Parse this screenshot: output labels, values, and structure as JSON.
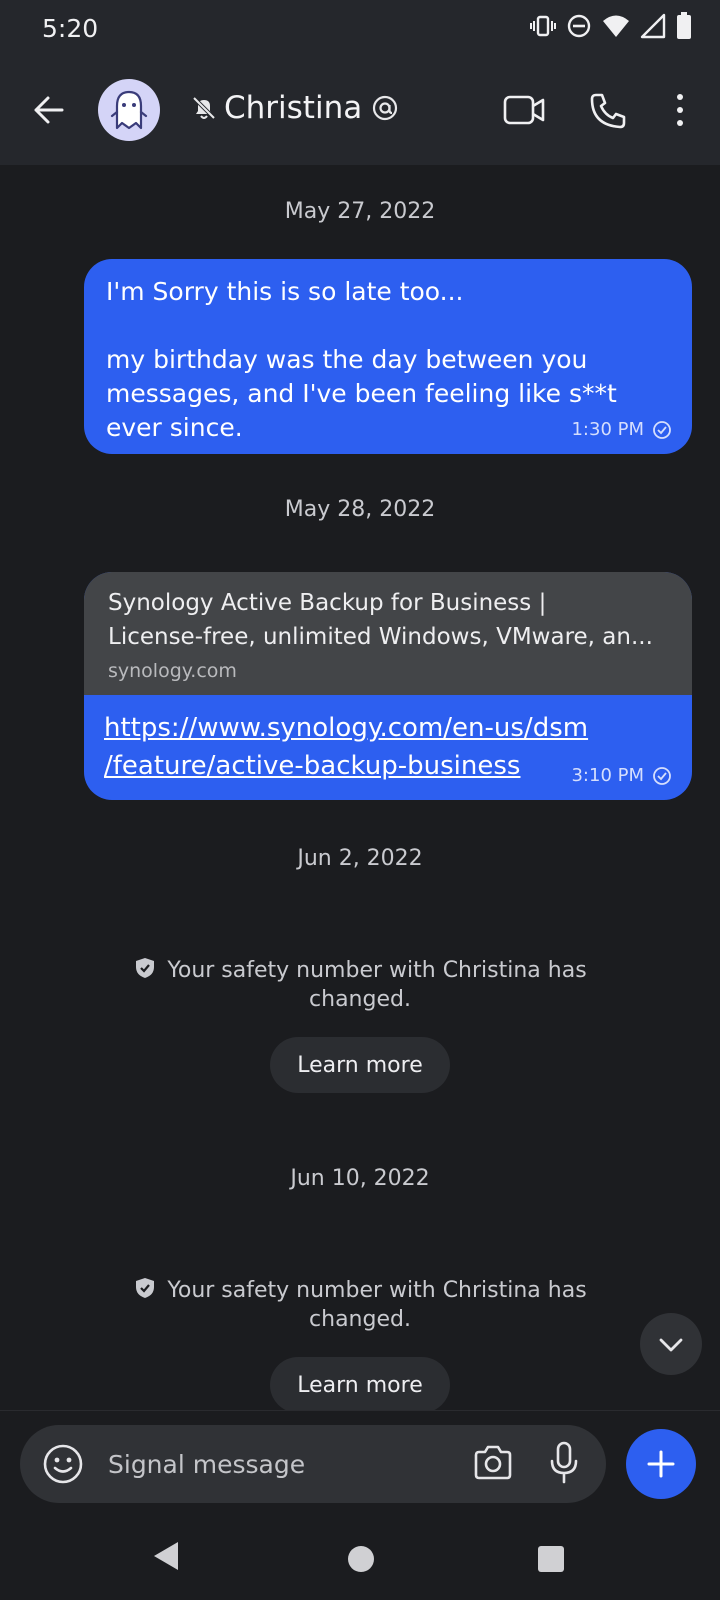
{
  "status_bar": {
    "time": "5:20"
  },
  "header": {
    "title": "Christina"
  },
  "conversation": {
    "groups": [
      {
        "date": "May 27, 2022",
        "message": {
          "text": "I'm Sorry this is so late too...\n\nmy birthday was the day between you messages, and I've been feeling like s**t ever since.",
          "time": "1:30 PM"
        }
      },
      {
        "date": "May 28, 2022",
        "message": {
          "preview_title_line1": "Synology Active Backup for Business |",
          "preview_title_line2": "License-free, unlimited Windows, VMware, an...",
          "preview_domain": "synology.com",
          "link_line1": "https://www.synology.com/en-us/dsm",
          "link_line2": "/feature/active-backup-business",
          "time": "3:10 PM"
        }
      },
      {
        "date": "Jun 2, 2022",
        "system_line1": "Your safety number with Christina has",
        "system_line2": "changed.",
        "button": "Learn more"
      },
      {
        "date": "Jun 10, 2022",
        "system_line1": "Your safety number with Christina has",
        "system_line2": "changed.",
        "button": "Learn more"
      }
    ]
  },
  "composer": {
    "placeholder": "Signal message"
  },
  "colors": {
    "accent": "#2d5ff0",
    "background": "#1b1c1f",
    "toolbar": "#25272c",
    "preview_card": "#434548"
  },
  "icons": [
    "vibrate-icon",
    "dnd-icon",
    "wifi-icon",
    "signal-icon",
    "battery-icon",
    "back-arrow-icon",
    "ghost-avatar-icon",
    "muted-bell-icon",
    "mention-icon",
    "video-call-icon",
    "phone-icon",
    "more-vert-icon",
    "sent-check-icon",
    "shield-check-icon",
    "chevron-down-icon",
    "emoji-icon",
    "camera-icon",
    "mic-icon",
    "plus-icon",
    "nav-back-icon",
    "nav-home-icon",
    "nav-recents-icon"
  ]
}
